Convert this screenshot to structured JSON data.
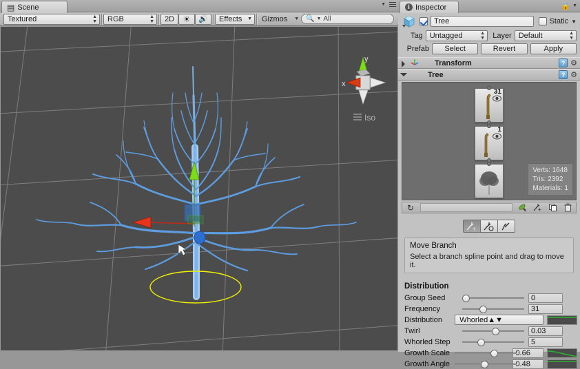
{
  "scene": {
    "tab_label": "Scene",
    "tab_icon": "grid-icon",
    "toolbar": {
      "draw_mode": "Textured",
      "render_mode": "RGB",
      "view_2d": "2D",
      "lighting_icon": "sun-icon",
      "audio_icon": "speaker-icon",
      "effects": "Effects",
      "gizmos": "Gizmos",
      "search_placeholder": "All",
      "search_icon": "search-icon",
      "menu_icon": "hamburger-icon"
    },
    "gizmo": {
      "x_label": "x",
      "y_label": "y",
      "projection_label": "Iso",
      "x_color": "#d83a14",
      "y_color": "#7ddb18",
      "z_color": "#e8e8e8"
    },
    "viewport": {
      "background": "#4c4c4c",
      "grid_color": "#989898",
      "branch_color": "#5b9ade",
      "selection_circle_color": "#f2f200",
      "move_gizmo": {
        "x_arrow_color": "#e8341c",
        "y_arrow_color": "#7ddb18",
        "handle_color": "#2d6fd0"
      },
      "cursor_icon": "arrow-cursor"
    }
  },
  "inspector": {
    "tab_label": "Inspector",
    "tab_icon": "info-icon",
    "lock_icon": "lock-icon",
    "menu_icon": "chevron-down-icon",
    "object": {
      "enabled": true,
      "name": "Tree",
      "static_label": "Static",
      "static_checked": false,
      "tag_label": "Tag",
      "tag_value": "Untagged",
      "layer_label": "Layer",
      "layer_value": "Default",
      "prefab_label": "Prefab",
      "prefab_select": "Select",
      "prefab_revert": "Revert",
      "prefab_apply": "Apply"
    },
    "components": [
      {
        "name": "Transform",
        "icon": "axis-icon",
        "expanded": false
      },
      {
        "name": "Tree",
        "icon": "tree-icon",
        "expanded": true
      }
    ],
    "tree_hierarchy": {
      "nodes": [
        {
          "type": "branch",
          "count": "31",
          "eye_icon": "eye-icon"
        },
        {
          "type": "branch",
          "count": "1",
          "eye_icon": "eye-icon"
        },
        {
          "type": "leaf",
          "count": "",
          "eye_icon": ""
        }
      ],
      "stats": {
        "verts_label": "Verts: 1648",
        "tris_label": "Tris: 2392",
        "materials_label": "Materials: 1"
      },
      "toolbar_icons": [
        "refresh-icon",
        "add-leaf-icon",
        "add-branch-icon",
        "duplicate-icon",
        "delete-icon"
      ]
    },
    "branch_tools": [
      {
        "name": "move-branch-tool",
        "icon": "branch-move-icon",
        "selected": true
      },
      {
        "name": "rotate-branch-tool",
        "icon": "branch-rotate-icon",
        "selected": false
      },
      {
        "name": "free-hand-tool",
        "icon": "branch-freehand-icon",
        "selected": false
      }
    ],
    "help": {
      "title": "Move Branch",
      "description": "Select a branch spline point and drag to move it."
    },
    "distribution": {
      "section_title": "Distribution",
      "properties": [
        {
          "label": "Group Seed",
          "value": "0",
          "slider": 0.0,
          "widget": "slider",
          "curve": null
        },
        {
          "label": "Frequency",
          "value": "31",
          "slider": 0.32,
          "widget": "slider",
          "curve": null
        },
        {
          "label": "Distribution",
          "value": "Whorled",
          "widget": "popup",
          "curve": "flat"
        },
        {
          "label": "Twirl",
          "value": "0.03",
          "slider": 0.55,
          "widget": "slider",
          "curve": null
        },
        {
          "label": "Whorled Step",
          "value": "5",
          "slider": 0.28,
          "widget": "slider",
          "curve": null
        },
        {
          "label": "Growth Scale",
          "value": "0.66",
          "slider": 0.66,
          "widget": "slider",
          "curve": "falling"
        },
        {
          "label": "Growth Angle",
          "value": "0.48",
          "slider": 0.48,
          "widget": "slider",
          "curve": "flat"
        }
      ],
      "curve_color": "#31b032"
    }
  }
}
